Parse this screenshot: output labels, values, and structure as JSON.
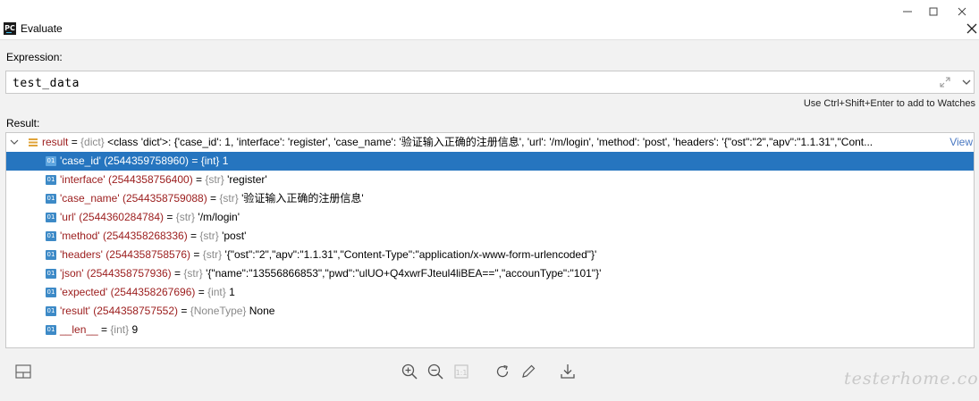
{
  "window": {
    "title": "Evaluate",
    "app_icon_text": "PC"
  },
  "expression": {
    "label": "Expression:",
    "value": "test_data"
  },
  "hint": "Use Ctrl+Shift+Enter to add to Watches",
  "result": {
    "label": "Result:",
    "root": {
      "name": "result",
      "type": "{dict}",
      "value": "<class 'dict'>: {'case_id': 1, 'interface': 'register', 'case_name': '验证输入正确的注册信息', 'url': '/m/login', 'method': 'post', 'headers': '{\"ost\":\"2\",\"apv\":\"1.1.31\",\"Cont...",
      "view_label": "View"
    },
    "items": [
      {
        "key": "'case_id' (2544359758960)",
        "type": "{int}",
        "value": "1"
      },
      {
        "key": "'interface' (2544358756400)",
        "type": "{str}",
        "value": "'register'"
      },
      {
        "key": "'case_name' (2544358759088)",
        "type": "{str}",
        "value": "'验证输入正确的注册信息'"
      },
      {
        "key": "'url' (2544360284784)",
        "type": "{str}",
        "value": "'/m/login'"
      },
      {
        "key": "'method' (2544358268336)",
        "type": "{str}",
        "value": "'post'"
      },
      {
        "key": "'headers' (2544358758576)",
        "type": "{str}",
        "value": "'{\"ost\":\"2\",\"apv\":\"1.1.31\",\"Content-Type\":\"application/x-www-form-urlencoded\"}'"
      },
      {
        "key": "'json' (2544358757936)",
        "type": "{str}",
        "value": "'{\"name\":\"13556866853\",\"pwd\":\"ulUO+Q4xwrFJteul4liBEA==\",\"accounType\":\"101\"}'"
      },
      {
        "key": "'expected' (2544358267696)",
        "type": "{int}",
        "value": "1"
      },
      {
        "key": "'result' (2544358757552)",
        "type": "{NoneType}",
        "value": "None"
      },
      {
        "key": "__len__",
        "type": "{int}",
        "value": "9"
      }
    ],
    "primitive_icon_text": "01"
  },
  "watermark": "testerhome.com",
  "colors": {
    "selection": "#2675bf",
    "key": "#9b1c1c",
    "type": "#8a8a8a",
    "link": "#4a78c2"
  }
}
